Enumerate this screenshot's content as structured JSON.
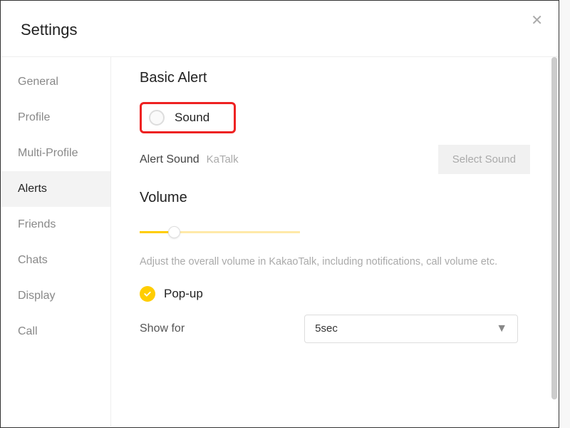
{
  "header": {
    "title": "Settings"
  },
  "sidebar": {
    "items": [
      {
        "label": "General"
      },
      {
        "label": "Profile"
      },
      {
        "label": "Multi-Profile"
      },
      {
        "label": "Alerts"
      },
      {
        "label": "Friends"
      },
      {
        "label": "Chats"
      },
      {
        "label": "Display"
      },
      {
        "label": "Call"
      }
    ]
  },
  "main": {
    "basic_alert_title": "Basic Alert",
    "sound_label": "Sound",
    "alert_sound_label": "Alert Sound",
    "alert_sound_value": "KaTalk",
    "select_sound_btn": "Select Sound",
    "volume_title": "Volume",
    "volume_desc": "Adjust the overall volume in KakaoTalk, including notifications, call volume etc.",
    "popup_label": "Pop-up",
    "show_for_label": "Show for",
    "show_for_value": "5sec"
  }
}
